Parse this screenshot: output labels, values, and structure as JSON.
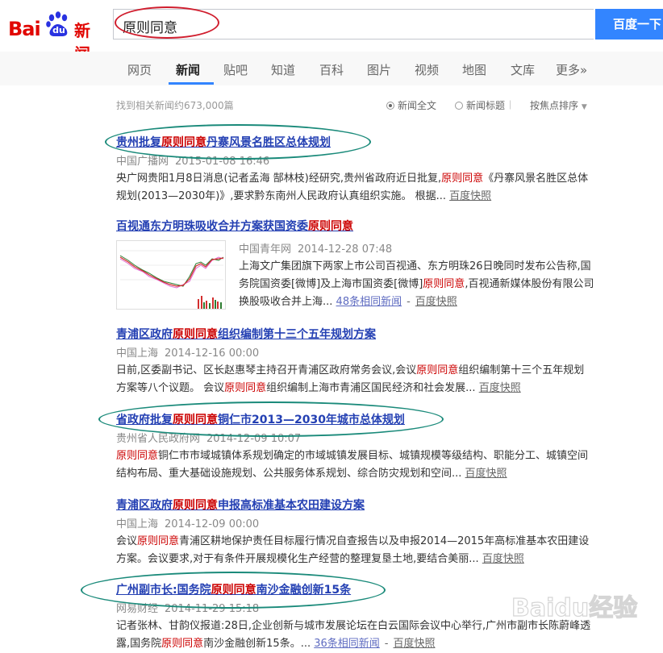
{
  "header": {
    "logo_bai": "Bai",
    "logo_du": "du",
    "logo_news": "新闻",
    "query": "原则同意",
    "search_button": "百度一下"
  },
  "nav": {
    "tabs": [
      "网页",
      "新闻",
      "贴吧",
      "知道",
      "百科",
      "图片",
      "视频",
      "地图",
      "文库",
      "更多»"
    ],
    "active": "新闻"
  },
  "toolbar": {
    "count": "找到相关新闻约673,000篇",
    "opt_full": "新闻全文",
    "opt_title": "新闻标题",
    "sep": "|",
    "sort": "按焦点排序"
  },
  "results": [
    {
      "title_pre": "贵州批复",
      "title_hl": "原则同意",
      "title_post": "丹寨风景名胜区总体规划",
      "source": "中国广播网",
      "date": "2015-01-08 16:46",
      "s1": "央广网贵阳1月8日消息(记者孟海 郜林枝)经研究,贵州省政府近日批复,",
      "s1_hl": "原则同意",
      "s1_post": "《丹寨风景名胜区总体规划(2013—2030年)》,要求黔东南州人民政府认真组织实施。 根据...",
      "snap": "百度快照"
    },
    {
      "title_pre": "百视通东方明珠吸收合并方案获国资委",
      "title_hl": "原则同意",
      "title_post": "",
      "source": "中国青年网",
      "date": "2014-12-28 07:48",
      "s1": "上海文广集团旗下两家上市公司百视通、东方明珠26日晚同时发布公告称,国务院国资委[微博]及上海市国资委[微博]",
      "s1_hl": "原则同意",
      "s1_post": ",百视通新媒体股份有限公司换股吸收合并上海...",
      "related": "48条相同新闻",
      "snap": "百度快照"
    },
    {
      "title_pre": "青浦区政府",
      "title_hl": "原则同意",
      "title_post": "组织编制第十三个五年规划方案",
      "source": "中国上海",
      "date": "2014-12-16 00:00",
      "s1": "日前,区委副书记、区长赵惠琴主持召开青浦区政府常务会议,会议",
      "s1_hl": "原则同意",
      "s1_post": "组织编制第十三个五年规划方案等八个议题。 会议",
      "s2_hl": "原则同意",
      "s2_post": "组织编制上海市青浦区国民经济和社会发展...",
      "snap": "百度快照"
    },
    {
      "title_pre": "省政府批复",
      "title_hl": "原则同意",
      "title_post": "铜仁市2013—2030年城市总体规划",
      "source": "贵州省人民政府网",
      "date": "2014-12-09 10:07",
      "s0_hl": "原则同意",
      "s1": "",
      "s1_hl": "",
      "s1_post": "铜仁市市域城镇体系规划确定的市域城镇发展目标、城镇规模等级结构、职能分工、城镇空间结构布局、重大基础设施规划、公共服务体系规划、综合防灾规划和空间...",
      "snap": "百度快照"
    },
    {
      "title_pre": "青浦区政府",
      "title_hl": "原则同意",
      "title_post": "申报高标准基本农田建设方案",
      "source": "中国上海",
      "date": "2014-12-09 00:00",
      "s1": "会议",
      "s1_hl": "原则同意",
      "s1_post": "青浦区耕地保护责任目标履行情况自查报告以及申报2014—2015年高标准基本农田建设方案。会议要求,对于有条件开展规模化生产经营的整理复垦土地,要结合美丽...",
      "snap": "百度快照"
    },
    {
      "title_pre": "广州副市长:国务院",
      "title_hl": "原则同意",
      "title_post": "南沙金融创新15条",
      "source": "网易财经",
      "date": "2014-11-29 15:18",
      "s1": "记者张林、甘韵仪报道:28日,企业创新与城市发展论坛在白云国际会议中心举行,广州市副市长陈蔚峰透露,国务院",
      "s1_hl": "原则同意",
      "s1_post": "南沙金融创新15条。...",
      "related": "36条相同新闻",
      "snap": "百度快照"
    }
  ],
  "watermark": "Baidu经验",
  "colors": {
    "accent": "#3385ff",
    "brand_red": "#e10602",
    "highlight": "#c00",
    "link": "#2440b3",
    "annotation_red": "#d01e2e",
    "annotation_teal": "#1a8a7a"
  }
}
